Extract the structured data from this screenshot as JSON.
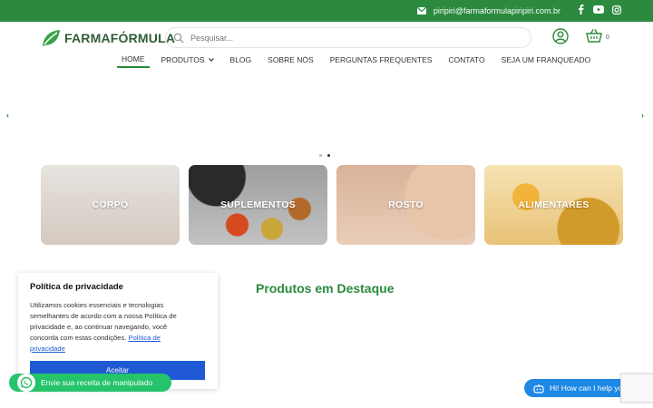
{
  "topbar": {
    "email": "piripiri@farmaformulapiripiri.com.br",
    "icons": [
      "mail-icon",
      "facebook-icon",
      "youtube-icon",
      "instagram-icon"
    ]
  },
  "brand": {
    "logo_text_a": "FARMA",
    "logo_text_b": "FÓRMULA",
    "green": "#2b8a3e"
  },
  "search": {
    "placeholder": "Pesquisar..."
  },
  "cart": {
    "count": "0"
  },
  "nav": {
    "items": [
      {
        "label": "HOME",
        "active": true
      },
      {
        "label": "PRODUTOS",
        "has_dropdown": true
      },
      {
        "label": "BLOG"
      },
      {
        "label": "SOBRE NÓS"
      },
      {
        "label": "PERGUNTAS FREQUENTES"
      },
      {
        "label": "CONTATO"
      },
      {
        "label": "SEJA UM FRANQUEADO"
      }
    ]
  },
  "slider": {
    "prev": "‹",
    "next": "›",
    "slides": 2,
    "active_slide": 2
  },
  "categories": [
    {
      "label": "CORPO"
    },
    {
      "label": "SUPLEMENTOS"
    },
    {
      "label": "ROSTO"
    },
    {
      "label": "ALIMENTARES"
    }
  ],
  "featured": {
    "title": "Produtos em Destaque"
  },
  "cookie": {
    "title": "Política de privacidade",
    "body": "Utilizamos cookies essenciais e tecnologias semelhantes de acordo com a nossa Política de privacidade e, ao continuar navegando, você concorda com estas condições.",
    "link": "Política de privacidade",
    "accept": "Aceitar",
    "accent": "#1f5ad4"
  },
  "whatsapp": {
    "label": "Envie sua receita de manipulado",
    "color": "#25c36a"
  },
  "help": {
    "label": "Hi! How can I help you?",
    "color": "#1e88e5"
  }
}
